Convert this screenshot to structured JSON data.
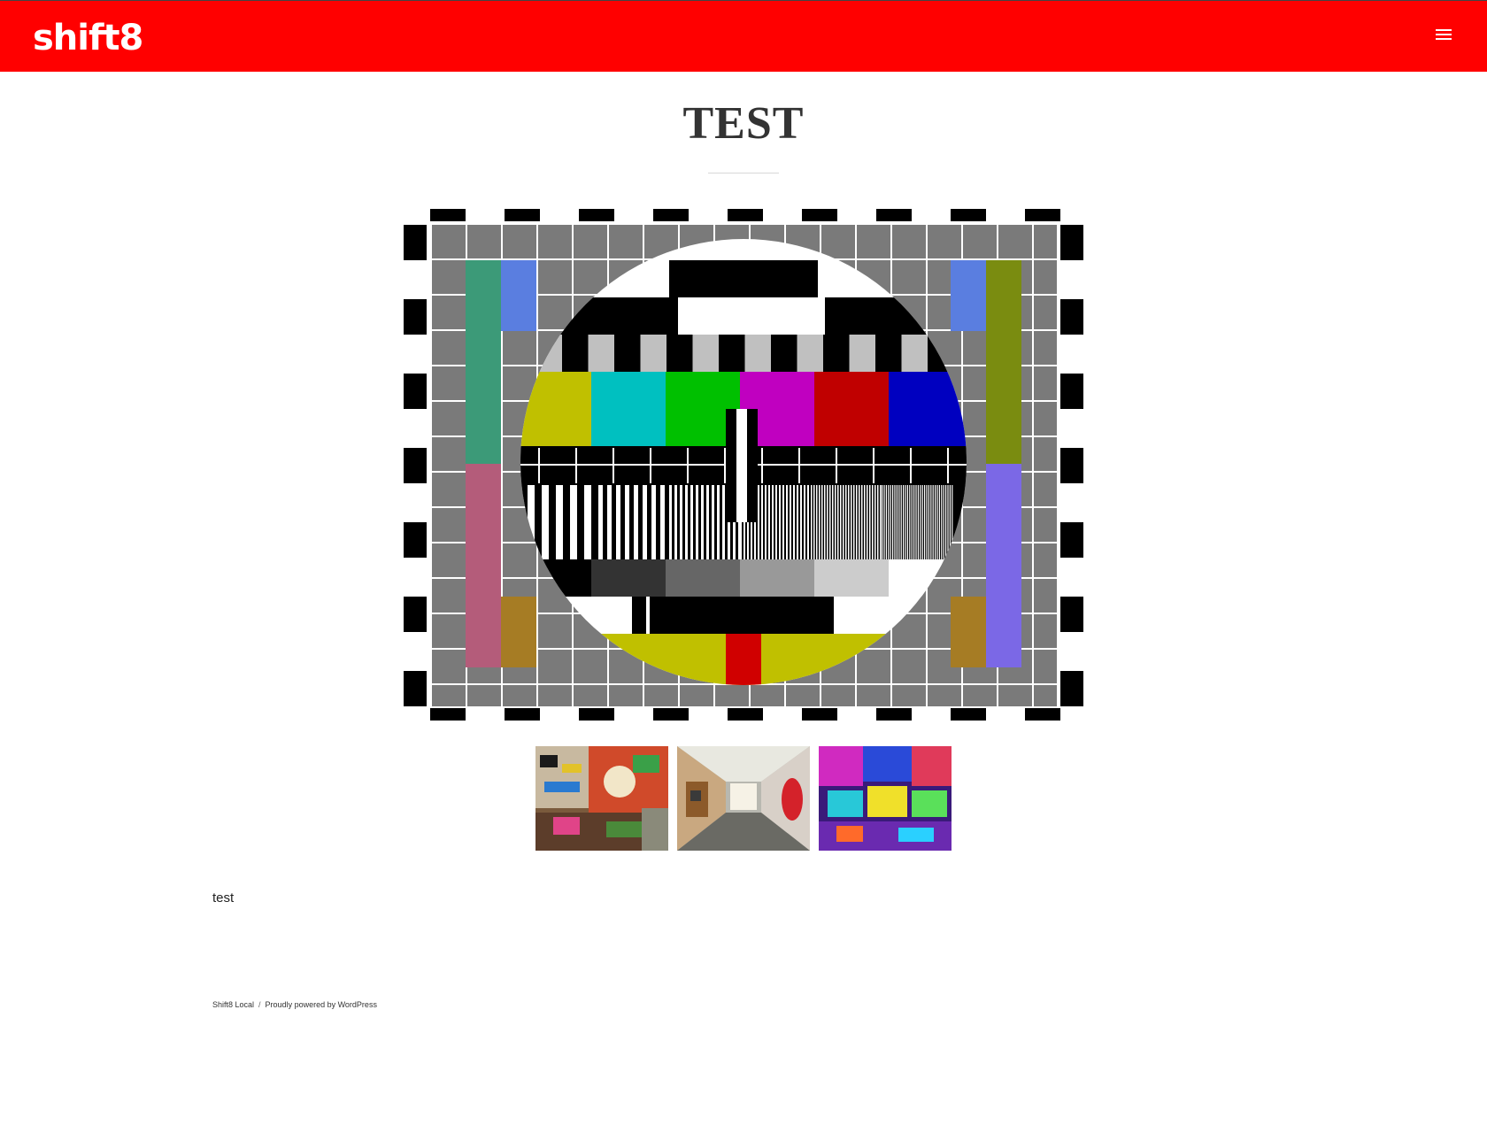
{
  "header": {
    "logo": "shift8",
    "menu_icon": "hamburger-menu-icon",
    "background": "#ff0000"
  },
  "page": {
    "title": "TEST",
    "body_text": "test"
  },
  "media": {
    "featured_image": "tv-test-card-image",
    "gallery": [
      {
        "name": "graffiti-room-thumbnail"
      },
      {
        "name": "graffiti-tunnel-thumbnail"
      },
      {
        "name": "neon-graffiti-thumbnail"
      }
    ]
  },
  "footer": {
    "site_name": "Shift8 Local",
    "separator": "/",
    "powered_by": "Proudly powered by WordPress"
  }
}
